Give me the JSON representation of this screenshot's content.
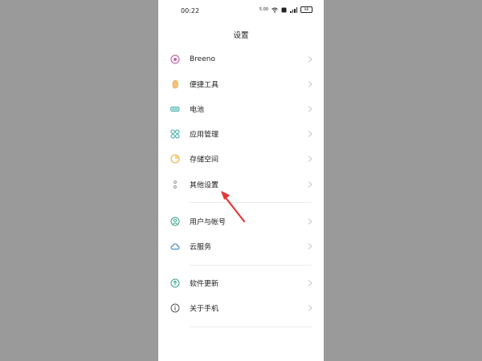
{
  "status_bar": {
    "time": "00:22",
    "speed": "5.00",
    "battery": "88"
  },
  "header": {
    "title": "设置"
  },
  "groups": [
    {
      "items": [
        {
          "label": "Breeno",
          "icon": "breeno-icon"
        },
        {
          "label": "便捷工具",
          "icon": "hand-icon"
        },
        {
          "label": "电池",
          "icon": "battery-icon"
        },
        {
          "label": "应用管理",
          "icon": "apps-icon"
        },
        {
          "label": "存储空间",
          "icon": "storage-icon"
        },
        {
          "label": "其他设置",
          "icon": "more-icon"
        }
      ]
    },
    {
      "items": [
        {
          "label": "用户与帐号",
          "icon": "user-icon"
        },
        {
          "label": "云服务",
          "icon": "cloud-icon"
        }
      ]
    },
    {
      "items": [
        {
          "label": "软件更新",
          "icon": "update-icon"
        },
        {
          "label": "关于手机",
          "icon": "info-icon"
        }
      ]
    }
  ],
  "colors": {
    "breeno": "#c86aa3",
    "hand": "#e8a64a",
    "battery": "#3aa8a0",
    "apps": "#3aa8a0",
    "storage": "#e8b040",
    "more": "#888888",
    "user": "#3aa38a",
    "cloud": "#2f7db8",
    "update": "#3aa38a",
    "info": "#555555",
    "annotation_arrow": "#e23a3a"
  }
}
